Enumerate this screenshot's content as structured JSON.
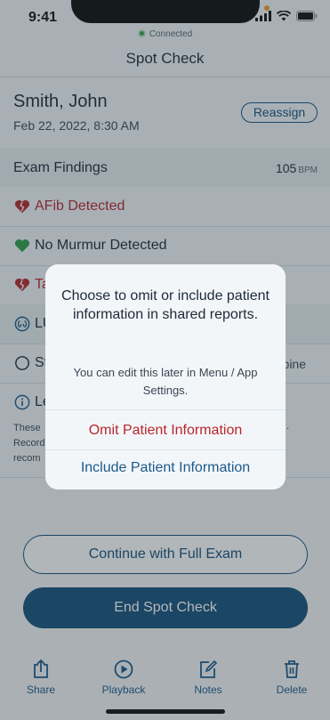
{
  "status_bar": {
    "time": "9:41"
  },
  "connection": {
    "status": "Connected"
  },
  "nav": {
    "title": "Spot Check"
  },
  "patient": {
    "name": "Smith, John",
    "date": "Feb 22, 2022, 8:30 AM",
    "reassign_label": "Reassign"
  },
  "findings": {
    "title": "Exam Findings",
    "bpm_value": "105",
    "bpm_unit": "BPM",
    "items": [
      {
        "label": "AFib Detected",
        "icon": "broken-heart-icon",
        "color": "#b8262d"
      },
      {
        "label": "No Murmur Detected",
        "icon": "heart-icon",
        "color": "#2e9e48"
      },
      {
        "label": "Ta",
        "icon": "broken-heart-icon",
        "color": "#b8262d"
      },
      {
        "label": "LU",
        "icon": "lungs-icon",
        "color": "#1c5a8a"
      },
      {
        "label": "St",
        "icon": "circle-icon",
        "color": "#1c2a38",
        "trailing": "pine"
      },
      {
        "label": "Le",
        "icon": "info-icon",
        "color": "#1c5a8a"
      }
    ],
    "legend_lines": [
      "These",
      "Record",
      "recom"
    ],
    "legend_trailing": "."
  },
  "actions": {
    "continue_label": "Continue with Full Exam",
    "end_label": "End Spot Check"
  },
  "tabbar": {
    "items": [
      {
        "label": "Share",
        "icon": "share-icon"
      },
      {
        "label": "Playback",
        "icon": "play-icon"
      },
      {
        "label": "Notes",
        "icon": "notes-icon"
      },
      {
        "label": "Delete",
        "icon": "trash-icon"
      }
    ]
  },
  "dialog": {
    "title": "Choose to omit or include patient information in shared reports.",
    "message": "You can edit this later in Menu / App Settings.",
    "omit_label": "Omit Patient Information",
    "include_label": "Include Patient Information"
  },
  "colors": {
    "primary": "#15507c",
    "danger": "#b8262d",
    "success": "#2e9e48"
  }
}
